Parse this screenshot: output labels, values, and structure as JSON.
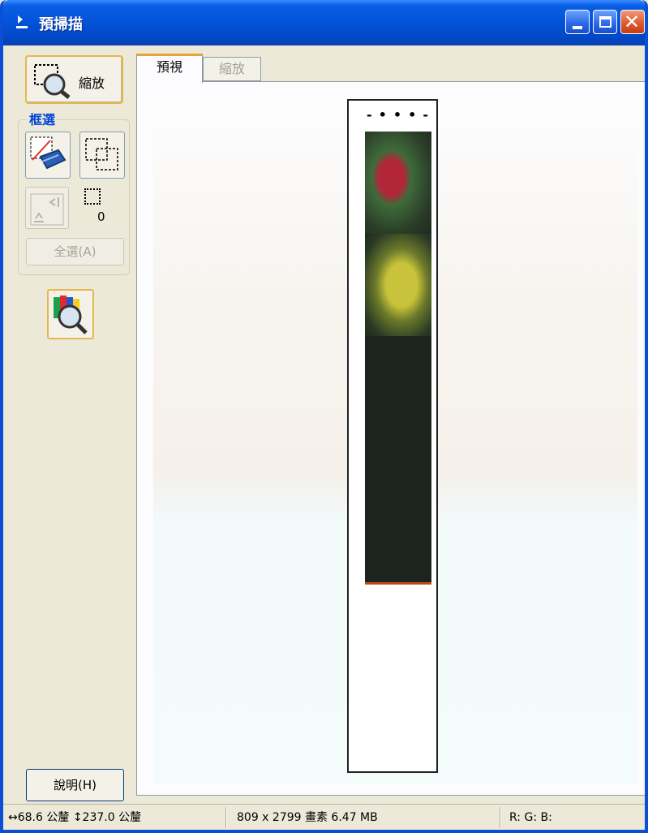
{
  "window": {
    "title": "預掃描"
  },
  "toolbar": {
    "zoom_label": "縮放",
    "marquee_group_label": "框選",
    "marquee_count": "0",
    "select_all_label": "全選(A)",
    "help_label": "說明(H)"
  },
  "tabs": [
    {
      "label": "預視",
      "active": true
    },
    {
      "label": "縮放",
      "active": false
    }
  ],
  "status": {
    "width_text": "↔68.6 公釐",
    "height_text": "↕237.0 公釐",
    "size_text": "809 x 2799 畫素 6.47 MB",
    "rgb_text": "R: G: B:"
  },
  "colors": {
    "title_bar": "#0352d9",
    "accent_border": "#e5b84d",
    "group_label": "#0046d5",
    "close_button": "#e05a30"
  },
  "icons": {
    "window": "scanner-icon",
    "zoom": "zoom-magnifier-icon",
    "auto_locate": "auto-locate-icon",
    "create_marquee": "create-marquee-icon",
    "scale_disabled": "scale-icon",
    "marquee_count": "marquee-count-icon",
    "color_palette": "color-palette-magnifier-icon"
  }
}
